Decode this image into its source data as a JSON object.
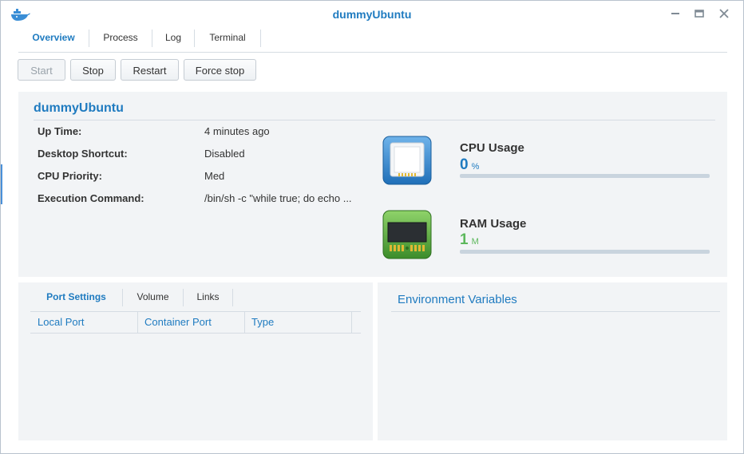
{
  "window": {
    "title": "dummyUbuntu",
    "app_icon": "docker-whale-icon"
  },
  "tabs": [
    "Overview",
    "Process",
    "Log",
    "Terminal"
  ],
  "active_tab": "Overview",
  "actions": {
    "start": "Start",
    "stop": "Stop",
    "restart": "Restart",
    "force_stop": "Force stop"
  },
  "summary": {
    "name": "dummyUbuntu",
    "rows": [
      {
        "label": "Up Time:",
        "value": "4 minutes ago"
      },
      {
        "label": "Desktop Shortcut:",
        "value": "Disabled"
      },
      {
        "label": "CPU Priority:",
        "value": "Med"
      },
      {
        "label": "Execution Command:",
        "value": "/bin/sh -c \"while true; do echo ..."
      }
    ],
    "cpu": {
      "title": "CPU Usage",
      "value": "0",
      "unit": "%",
      "fraction": 0.0,
      "color": "#1f7bc0",
      "icon": "cpu-chip-icon"
    },
    "ram": {
      "title": "RAM Usage",
      "value": "1",
      "unit": "M",
      "fraction": 0.0,
      "color": "#5cb85c",
      "icon": "ram-module-icon"
    }
  },
  "ports": {
    "tabs": [
      "Port Settings",
      "Volume",
      "Links"
    ],
    "active_tab": "Port Settings",
    "columns": [
      "Local Port",
      "Container Port",
      "Type"
    ]
  },
  "env": {
    "title": "Environment Variables"
  },
  "colors": {
    "accent": "#1f7bc0",
    "panel": "#f2f4f6"
  }
}
